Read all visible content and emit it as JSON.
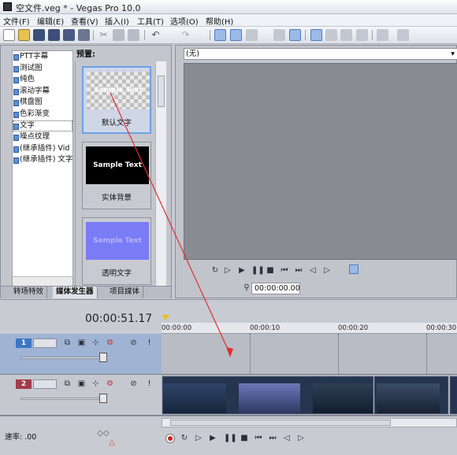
{
  "window": {
    "title": "空文件.veg * - Vegas Pro 10.0"
  },
  "menu": [
    "文件(F)",
    "编辑(E)",
    "查看(V)",
    "插入(I)",
    "工具(T)",
    "选项(O)",
    "帮助(H)"
  ],
  "generator_list": {
    "items": [
      "PTT字幕",
      "测试图",
      "纯色",
      "滚动字幕",
      "棋盘图",
      "色彩渐变",
      "文字",
      "噪点纹理",
      "(继承插件) Vid",
      "(继承插件) 文字"
    ],
    "selected": "文字"
  },
  "presets": {
    "label": "预置:",
    "cards": [
      {
        "label": "默认文字",
        "thumb_text": "Sample Text",
        "style": "checker"
      },
      {
        "label": "实体背景",
        "thumb_text": "Sample Text",
        "style": "black"
      },
      {
        "label": "透明文字",
        "thumb_text": "Sample Text",
        "style": "purple"
      }
    ]
  },
  "tabs": [
    "转场特效",
    "媒体发生器",
    "项目媒体"
  ],
  "active_tab": "媒体发生器",
  "preview": {
    "combo_value": "(无)",
    "timecode": "00:00:00.00"
  },
  "timeline": {
    "current_time": "00:00:51.17",
    "ruler": [
      "00:00:00",
      "00:00:10",
      "00:00:20",
      "00:00:30"
    ],
    "tracks": [
      {
        "number": "1",
        "type": "text",
        "color": "#3a78c4"
      },
      {
        "number": "2",
        "type": "video",
        "color": "#a33a4a"
      }
    ]
  },
  "rate": "速率: .00",
  "colors": {
    "arrow": "#e03030",
    "accent": "#6aa1e8"
  }
}
